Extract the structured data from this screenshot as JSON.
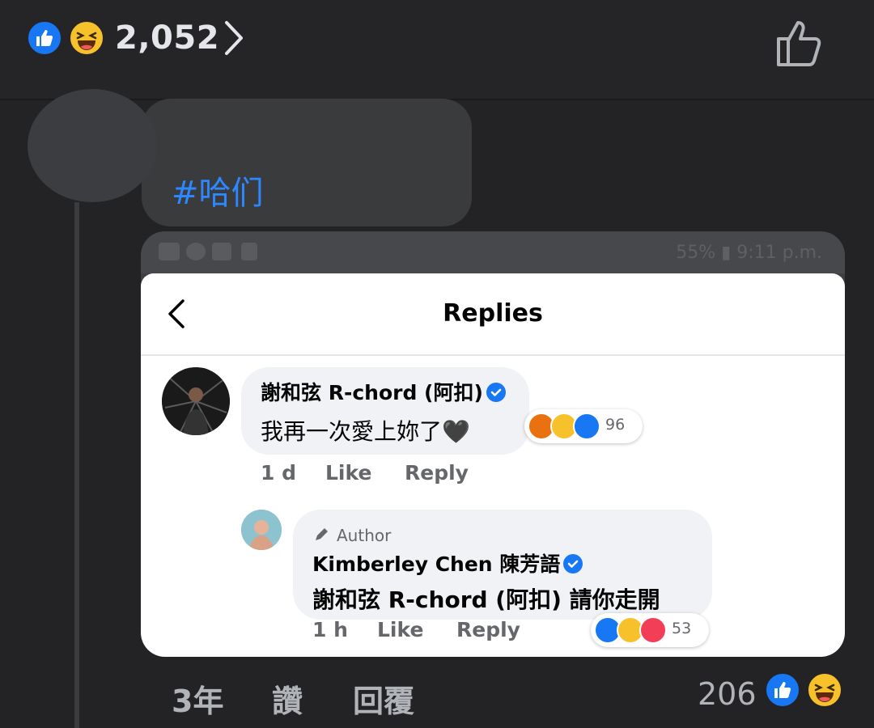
{
  "top": {
    "reaction_icons": [
      "like-icon",
      "haha-icon"
    ],
    "count": "2,052"
  },
  "post": {
    "hashtag": "#哈们"
  },
  "screenshot": {
    "status_text": "55% ▮ 9:11 p.m.",
    "title": "Replies",
    "comment1": {
      "name": "謝和弦 R-chord (阿扣)",
      "text": "我再一次愛上妳了🖤",
      "time": "1 d",
      "like": "Like",
      "reply": "Reply",
      "reaction_count": "96"
    },
    "comment2": {
      "badge": "Author",
      "name": "Kimberley Chen 陳芳語",
      "text": "謝和弦 R-chord (阿扣) 請你走開",
      "time": "1 h",
      "like": "Like",
      "reply": "Reply",
      "reaction_count": "53"
    }
  },
  "footer": {
    "time": "3年",
    "like": "讚",
    "reply": "回覆",
    "count": "206"
  },
  "colors": {
    "background": "#232325",
    "accent": "#1877f2",
    "hashtag": "#2d88ff",
    "haha": "#f7c12b",
    "love": "#f33e58",
    "angry": "#e9710f"
  }
}
